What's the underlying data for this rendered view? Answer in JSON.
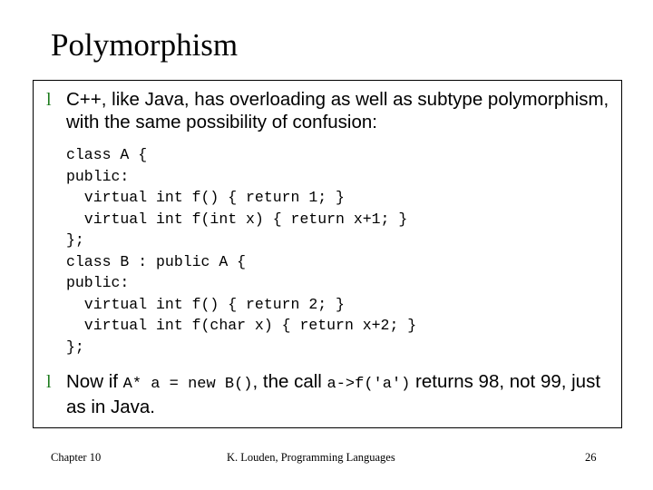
{
  "slide": {
    "title": "Polymorphism",
    "bullets": [
      {
        "marker": "l",
        "text": "C++, like Java, has overloading as well as subtype polymorphism, with the same possibility of confusion:"
      }
    ],
    "code": "class A {\npublic:\n  virtual int f() { return 1; }\n  virtual int f(int x) { return x+1; }\n};\nclass B : public A {\npublic:\n  virtual int f() { return 2; }\n  virtual int f(char x) { return x+2; }\n};",
    "second_bullet": {
      "marker": "l",
      "part1": "Now if ",
      "code1": "A* a = new B()",
      "part2": ", the call ",
      "code2": "a->f('a')",
      "part3": " returns 98, not 99, just as in Java."
    }
  },
  "footer": {
    "left": "Chapter 10",
    "center": "K. Louden, Programming Languages",
    "right": "26"
  },
  "colors": {
    "bullet_green": "#1a7a1a",
    "text_black": "#000000",
    "background": "#ffffff"
  }
}
